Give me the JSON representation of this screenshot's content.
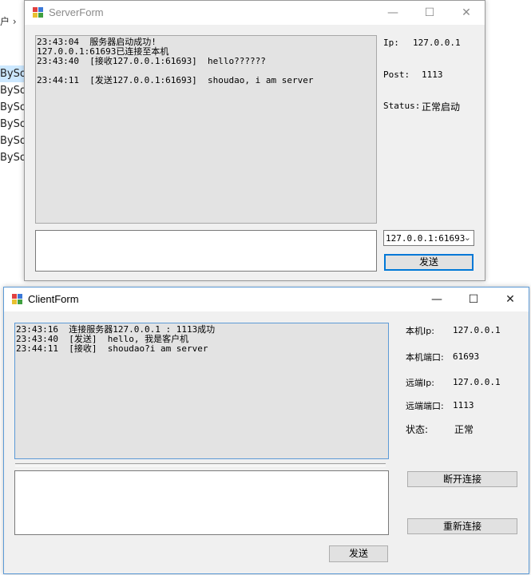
{
  "background": {
    "crumb": "户 ›",
    "items": [
      "BySoc",
      "BySoc",
      "BySoc",
      "BySoc",
      "BySoc",
      "BySoc"
    ]
  },
  "server": {
    "title": "ServerForm",
    "controls": {
      "minimize": "—",
      "maximize": "☐",
      "close": "✕"
    },
    "log": "23:43:04  服务器启动成功!\n127.0.0.1:61693已连接至本机\n23:43:40  [接收127.0.0.1:61693]  hello??????\n\n23:44:11  [发送127.0.0.1:61693]  shoudao, i am server",
    "ip_label": "Ip:",
    "ip_value": "127.0.0.1",
    "port_label": "Post:",
    "port_value": "1113",
    "status_label": "Status:",
    "status_value": "正常启动",
    "client_select": "127.0.0.1:61693",
    "send_button": "发送"
  },
  "client": {
    "title": "ClientForm",
    "controls": {
      "minimize": "—",
      "maximize": "☐",
      "close": "✕"
    },
    "log": "23:43:16  连接服务器127.0.0.1 : 1113成功\n23:43:40  [发送]  hello, 我是客户机\n23:44:11  [接收]  shoudao?i am server",
    "local_ip_label": "本机Ip:",
    "local_ip_value": "127.0.0.1",
    "local_port_label": "本机端口:",
    "local_port_value": "61693",
    "remote_ip_label": "远端Ip:",
    "remote_ip_value": "127.0.0.1",
    "remote_port_label": "远端端口:",
    "remote_port_value": "1113",
    "state_label": "状态:",
    "state_value": "正常",
    "disconnect_button": "断开连接",
    "reconnect_button": "重新连接",
    "send_button": "发送"
  }
}
